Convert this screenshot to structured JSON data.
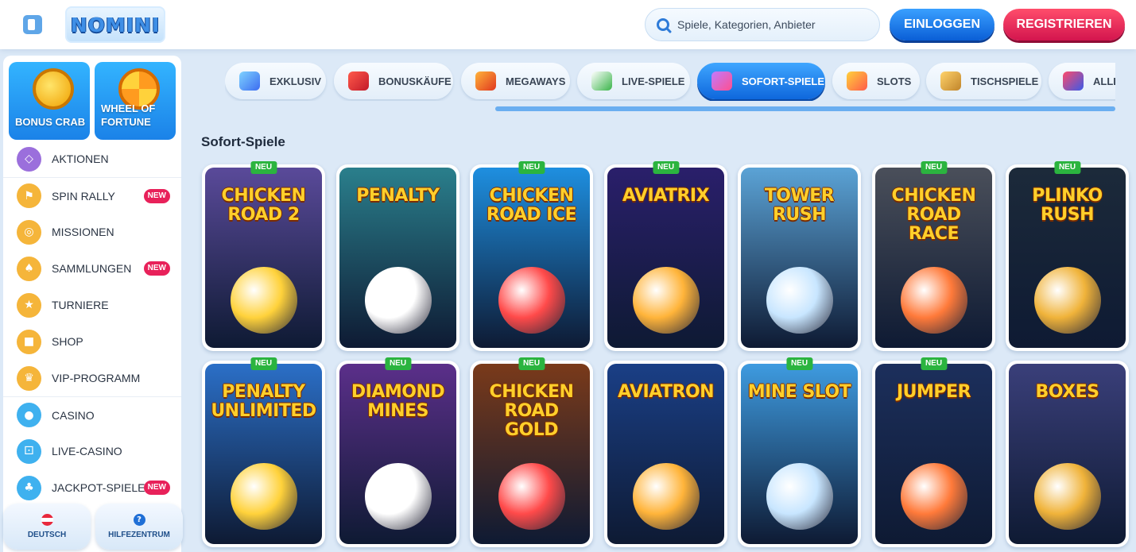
{
  "header": {
    "logo_text": "NOMINI",
    "search_placeholder": "Spiele, Kategorien, Anbieter",
    "login_label": "EINLOGGEN",
    "register_label": "REGISTRIEREN"
  },
  "sidebar": {
    "promos": [
      {
        "label": "BONUS CRAB"
      },
      {
        "label": "WHEEL OF FORTUNE"
      }
    ],
    "items": [
      {
        "label": "AKTIONEN",
        "icon": "gift-icon"
      },
      {
        "label": "SPIN RALLY",
        "icon": "flag-icon",
        "badge": "NEW"
      },
      {
        "label": "MISSIONEN",
        "icon": "target-icon"
      },
      {
        "label": "SAMMLUNGEN",
        "icon": "cards-icon",
        "badge": "NEW"
      },
      {
        "label": "TURNIERE",
        "icon": "trophy-icon"
      },
      {
        "label": "SHOP",
        "icon": "shop-icon"
      },
      {
        "label": "VIP-PROGRAMM",
        "icon": "crown-icon"
      },
      {
        "label": "CASINO",
        "icon": "cherries-icon"
      },
      {
        "label": "LIVE-CASINO",
        "icon": "dice-icon"
      },
      {
        "label": "JACKPOT-SPIELE",
        "icon": "clover-icon",
        "badge": "NEW"
      }
    ],
    "language_label": "DEUTSCH",
    "help_label": "HILFEZENTRUM"
  },
  "tabs": [
    {
      "label": "EXKLUSIV",
      "icon": "diamond-icon"
    },
    {
      "label": "BONUSKÄUFE",
      "icon": "gift-box-icon"
    },
    {
      "label": "MEGAWAYS",
      "icon": "megaways-m-icon"
    },
    {
      "label": "LIVE-SPIELE",
      "icon": "live-games-icon"
    },
    {
      "label": "SOFORT-SPIELE",
      "icon": "joystick-icon",
      "active": true
    },
    {
      "label": "SLOTS",
      "icon": "slots-icon"
    },
    {
      "label": "TISCHSPIELE",
      "icon": "table-games-icon"
    },
    {
      "label": "ALLE",
      "icon": "all-games-icon"
    }
  ],
  "section_title": "Sofort-Spiele",
  "new_badge": "NEU",
  "games": [
    {
      "title": "CHICKEN ROAD 2",
      "new": true,
      "bg": "#5a4a9a"
    },
    {
      "title": "PENALTY",
      "new": false,
      "bg": "#2a7f8c"
    },
    {
      "title": "CHICKEN ROAD ICE",
      "new": true,
      "bg": "#1e8fe0"
    },
    {
      "title": "Aviatrix",
      "new": true,
      "bg": "#2a1f6b"
    },
    {
      "title": "TOWER RUSH",
      "new": false,
      "bg": "#5ba3d6"
    },
    {
      "title": "CHICKEN ROAD RACE",
      "new": true,
      "bg": "#4a4f5a"
    },
    {
      "title": "PLINKO RUSH",
      "new": true,
      "bg": "#1c2a3a"
    },
    {
      "title": "PENALTY UNLIMITED",
      "new": true,
      "bg": "#2b6fc7"
    },
    {
      "title": "DIAMOND MINES",
      "new": true,
      "bg": "#5b2f8a"
    },
    {
      "title": "CHICKEN ROAD Gold",
      "new": true,
      "bg": "#7a3a1a"
    },
    {
      "title": "Aviatron",
      "new": false,
      "bg": "#1a3f86"
    },
    {
      "title": "MINE SLOT",
      "new": true,
      "bg": "#3e9be0"
    },
    {
      "title": "JUMPER",
      "new": true,
      "bg": "#1c2f5c"
    },
    {
      "title": "BOXES",
      "new": false,
      "bg": "#3a3f7a"
    }
  ]
}
